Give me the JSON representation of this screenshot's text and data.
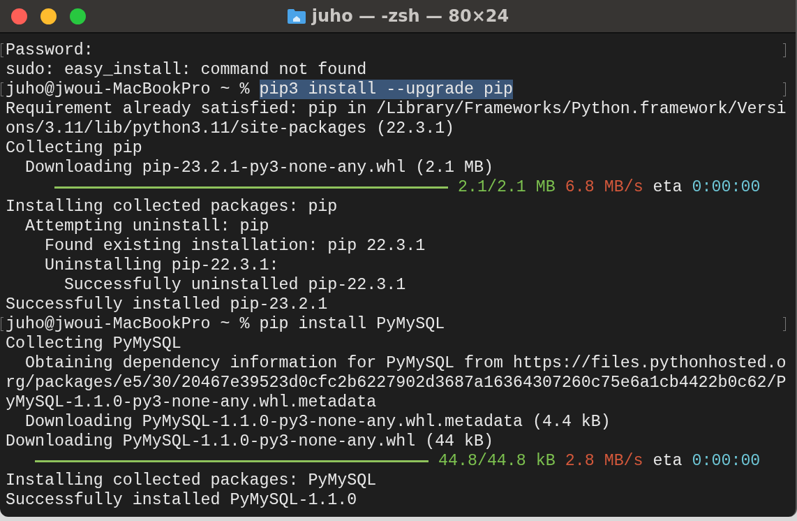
{
  "window": {
    "title": "juho — -zsh — 80×24"
  },
  "lines": [
    {
      "marked": true,
      "segments": [
        {
          "kind": "text",
          "text": "Password:"
        }
      ]
    },
    {
      "marked": false,
      "segments": [
        {
          "kind": "text",
          "text": "sudo: easy_install: command not found"
        }
      ]
    },
    {
      "marked": true,
      "segments": [
        {
          "kind": "text",
          "text": "juho@jwoui-MacBookPro ~ % "
        },
        {
          "kind": "selection",
          "text": "pip3 install --upgrade pip"
        }
      ]
    },
    {
      "marked": false,
      "segments": [
        {
          "kind": "text",
          "text": "Requirement already satisfied: pip in /Library/Frameworks/Python.framework/Versi"
        }
      ]
    },
    {
      "marked": false,
      "segments": [
        {
          "kind": "text",
          "text": "ons/3.11/lib/python3.11/site-packages (22.3.1)"
        }
      ]
    },
    {
      "marked": false,
      "segments": [
        {
          "kind": "text",
          "text": "Collecting pip"
        }
      ]
    },
    {
      "marked": false,
      "segments": [
        {
          "kind": "text",
          "text": "  Downloading pip-23.2.1-py3-none-any.whl (2.1 MB)"
        }
      ]
    },
    {
      "marked": false,
      "segments": [
        {
          "kind": "nested-bar",
          "level": 1
        },
        {
          "kind": "done",
          "text": " 2.1/2.1 MB"
        },
        {
          "kind": "speed",
          "text": " 6.8 MB/s"
        },
        {
          "kind": "text",
          "text": " eta"
        },
        {
          "kind": "eta",
          "text": " 0:00:00"
        }
      ]
    },
    {
      "marked": false,
      "segments": [
        {
          "kind": "text",
          "text": "Installing collected packages: pip"
        }
      ]
    },
    {
      "marked": false,
      "segments": [
        {
          "kind": "text",
          "text": "  Attempting uninstall: pip"
        }
      ]
    },
    {
      "marked": false,
      "segments": [
        {
          "kind": "text",
          "text": "    Found existing installation: pip 22.3.1"
        }
      ]
    },
    {
      "marked": false,
      "segments": [
        {
          "kind": "text",
          "text": "    Uninstalling pip-22.3.1:"
        }
      ]
    },
    {
      "marked": false,
      "segments": [
        {
          "kind": "text",
          "text": "      Successfully uninstalled pip-22.3.1"
        }
      ]
    },
    {
      "marked": false,
      "segments": [
        {
          "kind": "text",
          "text": "Successfully installed pip-23.2.1"
        }
      ]
    },
    {
      "marked": true,
      "segments": [
        {
          "kind": "text",
          "text": "juho@jwoui-MacBookPro ~ % pip install PyMySQL"
        }
      ]
    },
    {
      "marked": false,
      "segments": [
        {
          "kind": "text",
          "text": "Collecting PyMySQL"
        }
      ]
    },
    {
      "marked": false,
      "segments": [
        {
          "kind": "text",
          "text": "  Obtaining dependency information for PyMySQL from https://files.pythonhosted.o"
        }
      ]
    },
    {
      "marked": false,
      "segments": [
        {
          "kind": "text",
          "text": "rg/packages/e5/30/20467e39523d0cfc2b6227902d3687a16364307260c75e6a1cb4422b0c62/P"
        }
      ]
    },
    {
      "marked": false,
      "segments": [
        {
          "kind": "text",
          "text": "yMySQL-1.1.0-py3-none-any.whl.metadata"
        }
      ]
    },
    {
      "marked": false,
      "segments": [
        {
          "kind": "text",
          "text": "  Downloading PyMySQL-1.1.0-py3-none-any.whl.metadata (4.4 kB)"
        }
      ]
    },
    {
      "marked": false,
      "segments": [
        {
          "kind": "text",
          "text": "Downloading PyMySQL-1.1.0-py3-none-any.whl (44 kB)"
        }
      ]
    },
    {
      "marked": false,
      "segments": [
        {
          "kind": "bar",
          "level": 1
        },
        {
          "kind": "done",
          "text": " 44.8/44.8 kB"
        },
        {
          "kind": "speed",
          "text": " 2.8 MB/s"
        },
        {
          "kind": "text",
          "text": " eta"
        },
        {
          "kind": "eta",
          "text": " 0:00:00"
        }
      ]
    },
    {
      "marked": false,
      "segments": [
        {
          "kind": "text",
          "text": "Installing collected packages: PyMySQL"
        }
      ]
    },
    {
      "marked": false,
      "segments": [
        {
          "kind": "text",
          "text": "Successfully installed PyMySQL-1.1.0"
        }
      ]
    }
  ]
}
